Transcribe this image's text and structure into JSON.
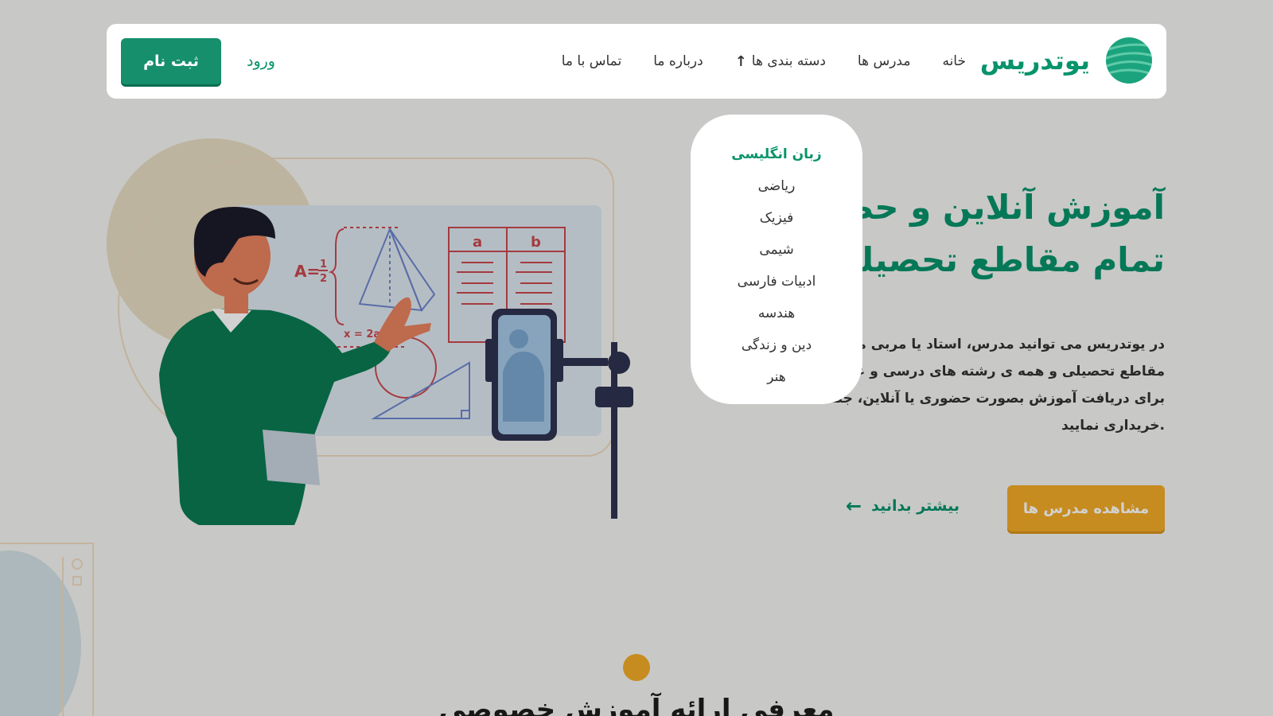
{
  "brand": {
    "name": "یوتدریس",
    "accent": "#07936b",
    "secondary": "#f2ab28",
    "logo_icon": "striped-globe-icon"
  },
  "nav": {
    "items": [
      {
        "label": "خانه"
      },
      {
        "label": "مدرس ها"
      },
      {
        "label": "دسته بندی ها",
        "icon": "arrow-up-icon"
      },
      {
        "label": "درباره ما"
      },
      {
        "label": "تماس با ما"
      }
    ],
    "login": "ورود",
    "signup": "ثبت نام"
  },
  "dropdown": {
    "items": [
      {
        "label": "زبان انگلیسی",
        "active": true
      },
      {
        "label": "ریاضی"
      },
      {
        "label": "فیزیک"
      },
      {
        "label": "شیمی"
      },
      {
        "label": "ادبیات فارسی"
      },
      {
        "label": "هندسه"
      },
      {
        "label": "دین و زندگی"
      },
      {
        "label": "هنر"
      }
    ]
  },
  "hero": {
    "title_line1": "آموزش آنلاین و حضوری",
    "title_line2": "تمام مقاطع تحصیلی و",
    "desc_line1": "در یوتدریس می توانید مدرس، استاد یا مربی مد نظر",
    "desc_line2": "مقاطع تحصیلی و همه ی رشته های درسی و غیردرسی",
    "desc_line3": "برای دریافت آموزش بصورت حضوری یا آنلاین، جلسه ی",
    "desc_line4": ".خریداری نمایید",
    "learn_more": "بیشتر بدانید",
    "cta": "مشاهده مدرس ها"
  },
  "illustration": {
    "formula_area": "A=",
    "formula_frac_num": "1",
    "formula_frac_den": "2",
    "formula_eq": "x = 2ab",
    "table_col_a": "a",
    "table_col_b": "b"
  },
  "section": {
    "title_partial": "معرفی ارائه آموزش خصوصی"
  }
}
